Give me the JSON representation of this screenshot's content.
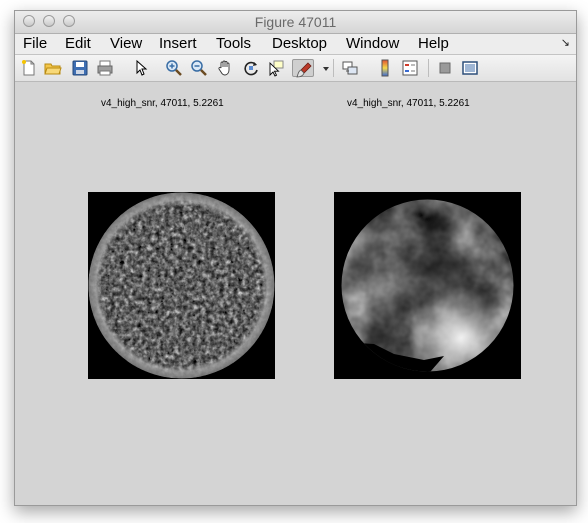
{
  "window": {
    "title": "Figure 47011"
  },
  "menu": {
    "items": [
      "File",
      "Edit",
      "View",
      "Insert",
      "Tools",
      "Desktop",
      "Window",
      "Help"
    ],
    "overflow_icon": "arrow-icon"
  },
  "toolbar": {
    "icons": [
      "new-figure-icon",
      "open-file-icon",
      "save-icon",
      "print-icon",
      "pointer-icon",
      "zoom-in-icon",
      "zoom-out-icon",
      "pan-hand-icon",
      "rotate-3d-icon",
      "data-cursor-icon",
      "brush-icon",
      "dropdown-icon",
      "link-plot-icon",
      "colorbar-icon",
      "legend-icon",
      "hide-plot-tools-icon",
      "show-plot-tools-icon"
    ]
  },
  "plots": [
    {
      "title": "v4_high_snr, 47011, 5.2261"
    },
    {
      "title": "v4_high_snr, 47011, 5.2261"
    }
  ],
  "colors": {
    "window_bg": "#d4d4d4",
    "axes_bg": "#000000"
  }
}
